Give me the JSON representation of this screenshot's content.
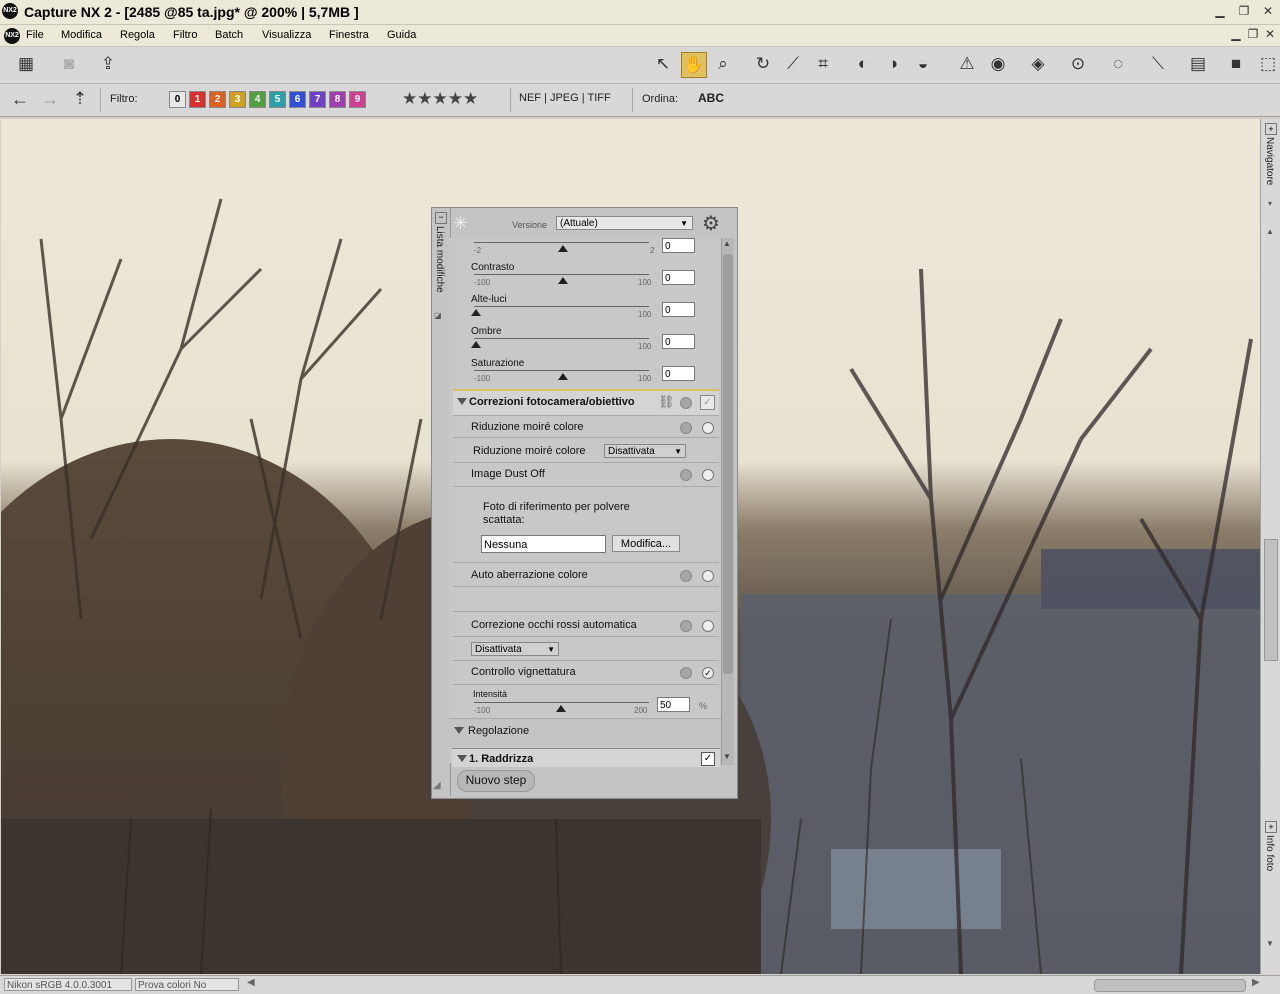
{
  "window": {
    "title": "Capture NX 2 - [2485 @85 ta.jpg* @ 200% | 5,7MB ]",
    "app_icon": "NX2"
  },
  "menu": [
    "File",
    "Modifica",
    "Regola",
    "Filtro",
    "Batch",
    "Visualizza",
    "Finestra",
    "Guida"
  ],
  "toolbar2": {
    "filter_label": "Filtro:",
    "ratings": [
      "0",
      "1",
      "2",
      "3",
      "4",
      "5",
      "6",
      "7",
      "8",
      "9"
    ],
    "rating_colors": [
      "#e8e8e8",
      "#d83030",
      "#e06020",
      "#d0a020",
      "#50a040",
      "#2aa0a8",
      "#3050d8",
      "#7040c8",
      "#a040b0",
      "#d04090"
    ],
    "stars": "★★★★★",
    "formats": "NEF | JPEG | TIFF",
    "sort_label": "Ordina:",
    "sort_value": "ABC"
  },
  "panel": {
    "sidebar_label": "Lista modifiche",
    "version_label": "Versione",
    "version_value": "(Attuale)",
    "top_slider": {
      "min": "-2",
      "max": "2",
      "value": "0"
    },
    "sliders": [
      {
        "label": "Contrasto",
        "min": "-100",
        "max": "100",
        "value": "0"
      },
      {
        "label": "Alte-luci",
        "min": "",
        "max": "100",
        "value": "0"
      },
      {
        "label": "Ombre",
        "min": "",
        "max": "100",
        "value": "0"
      },
      {
        "label": "Saturazione",
        "min": "-100",
        "max": "100",
        "value": "0"
      }
    ],
    "section_camera": "Correzioni fotocamera/obiettivo",
    "moire_title": "Riduzione moiré colore",
    "moire_label": "Riduzione moiré colore",
    "moire_value": "Disattivata",
    "dust_title": "Image Dust Off",
    "dust_text_1": "Foto di riferimento per polvere",
    "dust_text_2": "scattata:",
    "dust_value": "Nessuna",
    "dust_button": "Modifica...",
    "aberration_title": "Auto aberrazione colore",
    "redeye_title": "Correzione occhi rossi automatica",
    "redeye_value": "Disattivata",
    "vignette_title": "Controllo vignettatura",
    "vignette_label": "Intensità",
    "vignette_min": "-100",
    "vignette_max": "200",
    "vignette_value": "50",
    "vignette_unit": "%",
    "section_adjust": "Regolazione",
    "step_1": "1. Raddrizza",
    "new_step_button": "Nuovo step"
  },
  "right_tabs": {
    "navigator": "Navigatore",
    "info": "Info foto"
  },
  "status": {
    "profile": "Nikon sRGB 4.0.0.3001",
    "proof": "Prova colori No"
  }
}
